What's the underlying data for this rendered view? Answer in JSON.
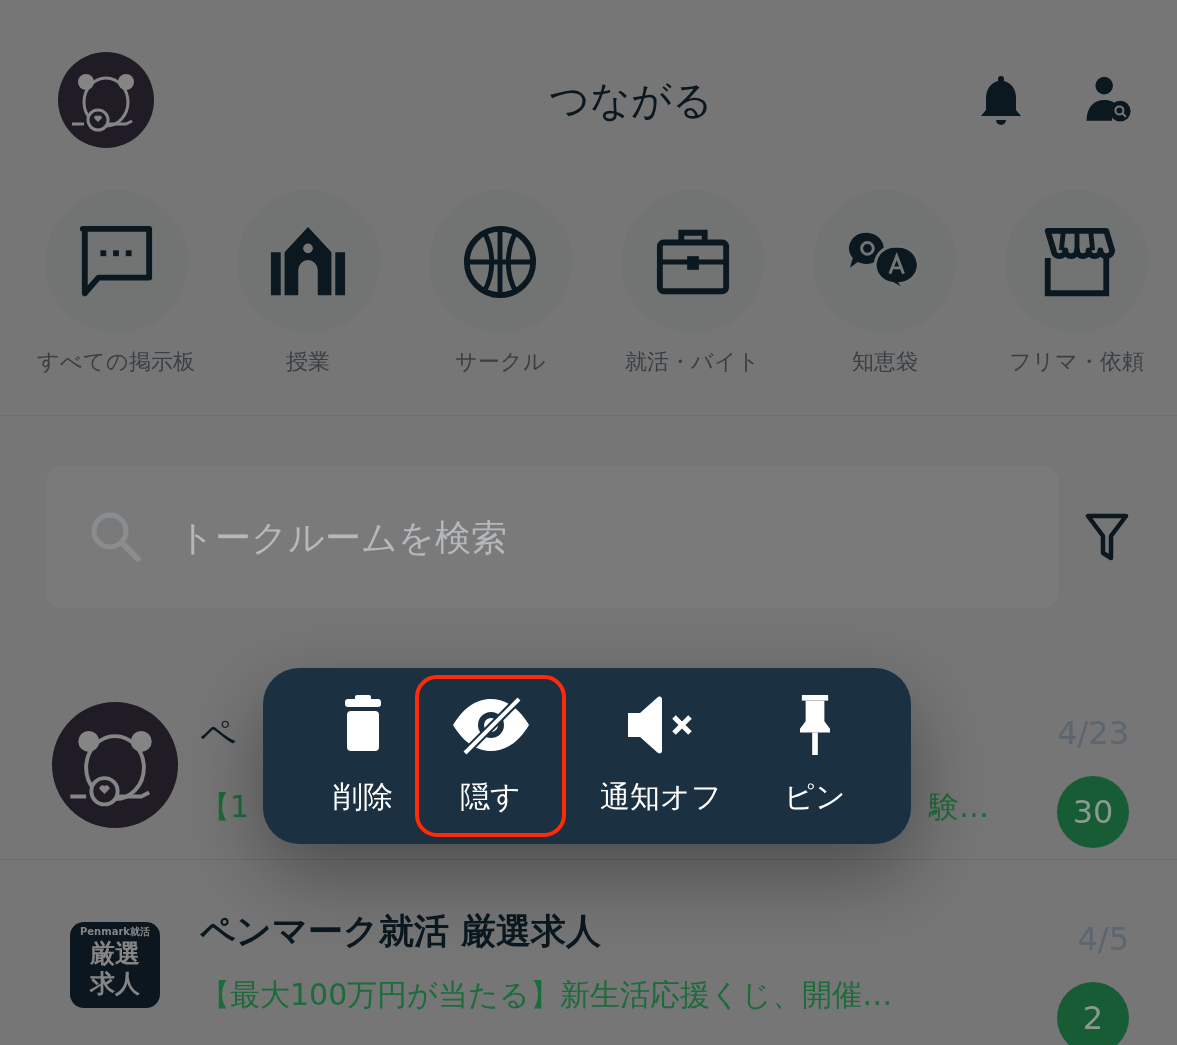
{
  "header": {
    "title": "つながる"
  },
  "categories": [
    {
      "label": "すべての掲示板",
      "kind": "board"
    },
    {
      "label": "授業",
      "kind": "class"
    },
    {
      "label": "サークル",
      "kind": "circle"
    },
    {
      "label": "就活・バイト",
      "kind": "job"
    },
    {
      "label": "知恵袋",
      "kind": "qa"
    },
    {
      "label": "フリマ・依頼",
      "kind": "market"
    }
  ],
  "search": {
    "placeholder": "トークルームを検索"
  },
  "rooms": [
    {
      "kind": "bear",
      "name": "ペ",
      "preview_parts": [
        "【1",
        "験…"
      ],
      "date": "4/23",
      "unread": "30"
    },
    {
      "kind": "tile",
      "tile_caption": "Penmark就活",
      "tile_lines": [
        "厳選",
        "求人"
      ],
      "name": "ペンマーク就活 厳選求人",
      "preview_parts": [
        "【最大100万円が当たる】新生活応援くじ、開催…"
      ],
      "date": "4/5",
      "unread": "2"
    }
  ],
  "context_menu": {
    "items": [
      {
        "label": "削除",
        "kind": "delete",
        "highlighted": false
      },
      {
        "label": "隠す",
        "kind": "hide",
        "highlighted": true
      },
      {
        "label": "通知オフ",
        "kind": "mute",
        "highlighted": false
      },
      {
        "label": "ピン",
        "kind": "pin",
        "highlighted": false
      }
    ]
  }
}
